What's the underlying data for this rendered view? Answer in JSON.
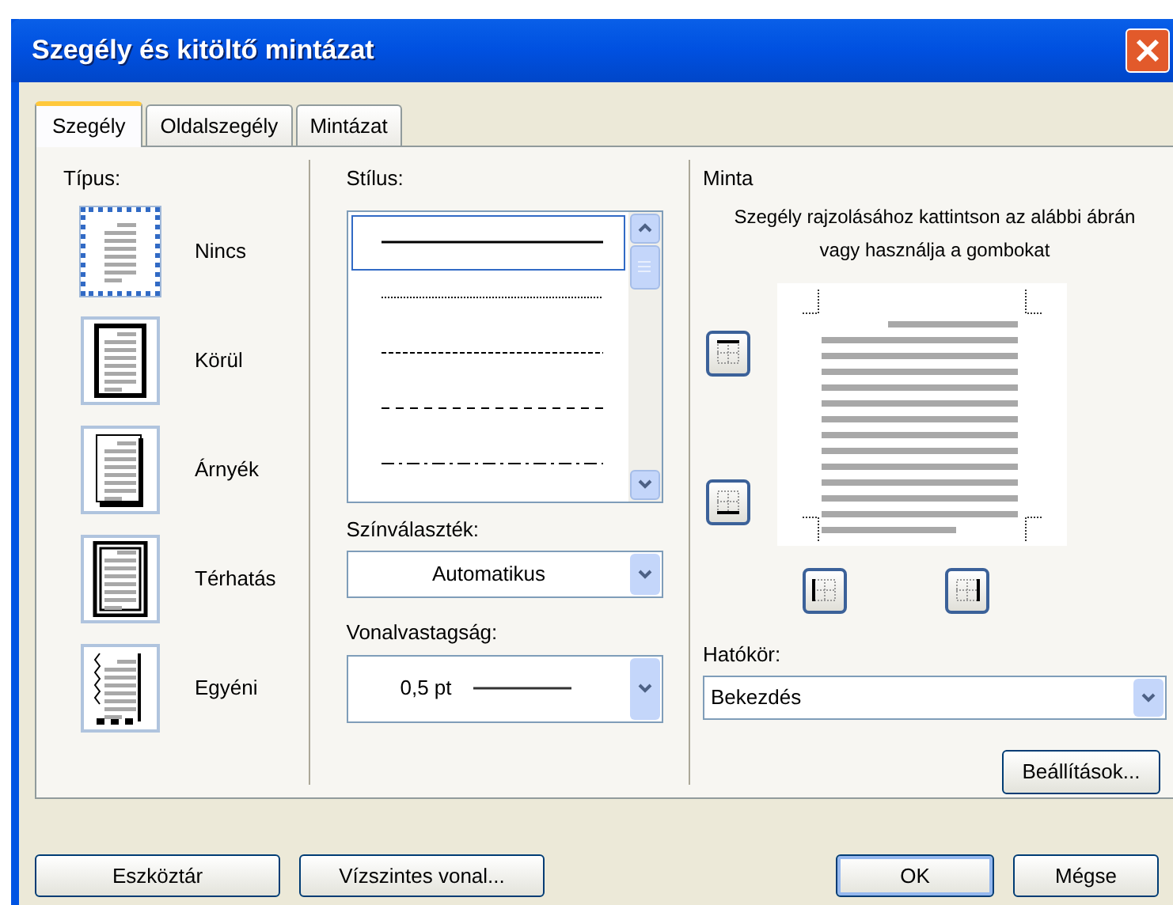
{
  "window": {
    "title": "Szegély és kitöltő mintázat"
  },
  "tabs": [
    {
      "label": "Szegély",
      "selected": true
    },
    {
      "label": "Oldalszegély",
      "selected": false
    },
    {
      "label": "Mintázat",
      "selected": false
    }
  ],
  "type": {
    "label": "Típus:",
    "items": [
      {
        "label": "Nincs",
        "kind": "none",
        "selected": true
      },
      {
        "label": "Körül",
        "kind": "box",
        "selected": false
      },
      {
        "label": "Árnyék",
        "kind": "shadow",
        "selected": false
      },
      {
        "label": "Térhatás",
        "kind": "raised",
        "selected": false
      },
      {
        "label": "Egyéni",
        "kind": "custom",
        "selected": false
      }
    ]
  },
  "style": {
    "label": "Stílus:",
    "items": [
      {
        "kind": "solid",
        "selected": true
      },
      {
        "kind": "dotted",
        "selected": false
      },
      {
        "kind": "dashed",
        "selected": false
      },
      {
        "kind": "dashed-wide",
        "selected": false
      },
      {
        "kind": "dash-dot",
        "selected": false
      }
    ]
  },
  "color": {
    "label": "Színválaszték:",
    "value": "Automatikus"
  },
  "width": {
    "label": "Vonalvastagság:",
    "value": "0,5 pt"
  },
  "preview": {
    "label": "Minta",
    "hint": "Szegély rajzolásához kattintson az alábbi ábrán vagy használja a gombokat",
    "buttons": [
      {
        "kind": "top"
      },
      {
        "kind": "bottom"
      },
      {
        "kind": "left"
      },
      {
        "kind": "right"
      }
    ]
  },
  "scope": {
    "label": "Hatókör:",
    "value": "Bekezdés"
  },
  "options_button": "Beállítások...",
  "buttons": [
    "Eszköztár",
    "Vízszintes vonal...",
    "OK",
    "Mégse"
  ]
}
